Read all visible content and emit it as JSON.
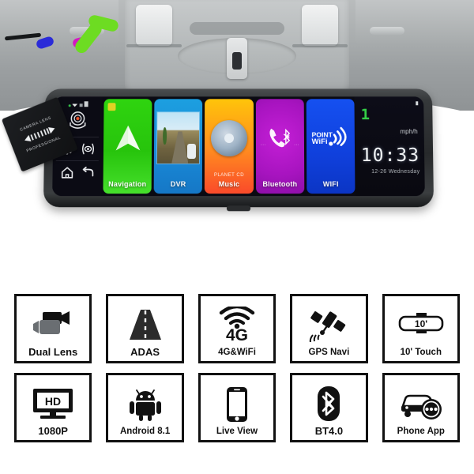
{
  "product": {
    "type": "smart-rearview-mirror-dashcam",
    "lens_tab": {
      "line1": "CAMERA LENS",
      "line2": "PROFESSIONAL"
    }
  },
  "device_screen": {
    "status_icons": [
      "signal-dot-icon",
      "wifi-icon",
      "bars-icon",
      "battery-icon"
    ],
    "controls": [
      {
        "name": "camera-icon",
        "glyph": "camera"
      },
      {
        "name": "settings-gear-icon",
        "glyph": "gear"
      },
      {
        "name": "recording-eye-icon",
        "glyph": "eye"
      },
      {
        "name": "home-icon",
        "glyph": "home"
      },
      {
        "name": "back-arrow-icon",
        "glyph": "back"
      }
    ],
    "tiles": [
      {
        "label": "Navigation",
        "icon": "navigation-arrow-icon",
        "color": "#2fd40f"
      },
      {
        "label": "DVR",
        "icon": "dvr-road-thumbnail-icon",
        "color": "#1c9fe0"
      },
      {
        "label": "Music",
        "icon": "music-album-disc-icon",
        "color": "#ff8a20",
        "art_caption": "PLANET CD"
      },
      {
        "label": "Bluetooth",
        "icon": "bluetooth-phone-icon",
        "color": "#c41fd6"
      },
      {
        "label": "WIFI",
        "icon": "point-wifi-icon",
        "color": "#1550f0",
        "art_caption": "POINT WiFi"
      }
    ],
    "info_panel": {
      "speed_value": "1",
      "speed_unit": "mph/h",
      "time": "10:33",
      "date": "12-26 Wednesday"
    }
  },
  "features": [
    {
      "label": "Dual Lens",
      "icon": "dual-camera-icon"
    },
    {
      "label": "ADAS",
      "icon": "road-lane-icon"
    },
    {
      "label": "4G&WiFi",
      "icon": "wifi-signal-icon",
      "big_text": "4G"
    },
    {
      "label": "GPS Navi",
      "icon": "satellite-icon"
    },
    {
      "label": "10' Touch",
      "icon": "mirror-screen-icon",
      "inner_text": "10'"
    },
    {
      "label": "1080P",
      "icon": "hd-monitor-icon",
      "inner_text": "HD"
    },
    {
      "label": "Android 8.1",
      "icon": "android-robot-icon"
    },
    {
      "label": "Live View",
      "icon": "smartphone-icon"
    },
    {
      "label": "BT4.0",
      "icon": "bluetooth-icon"
    },
    {
      "label": "Phone App",
      "icon": "car-app-icon"
    }
  ]
}
